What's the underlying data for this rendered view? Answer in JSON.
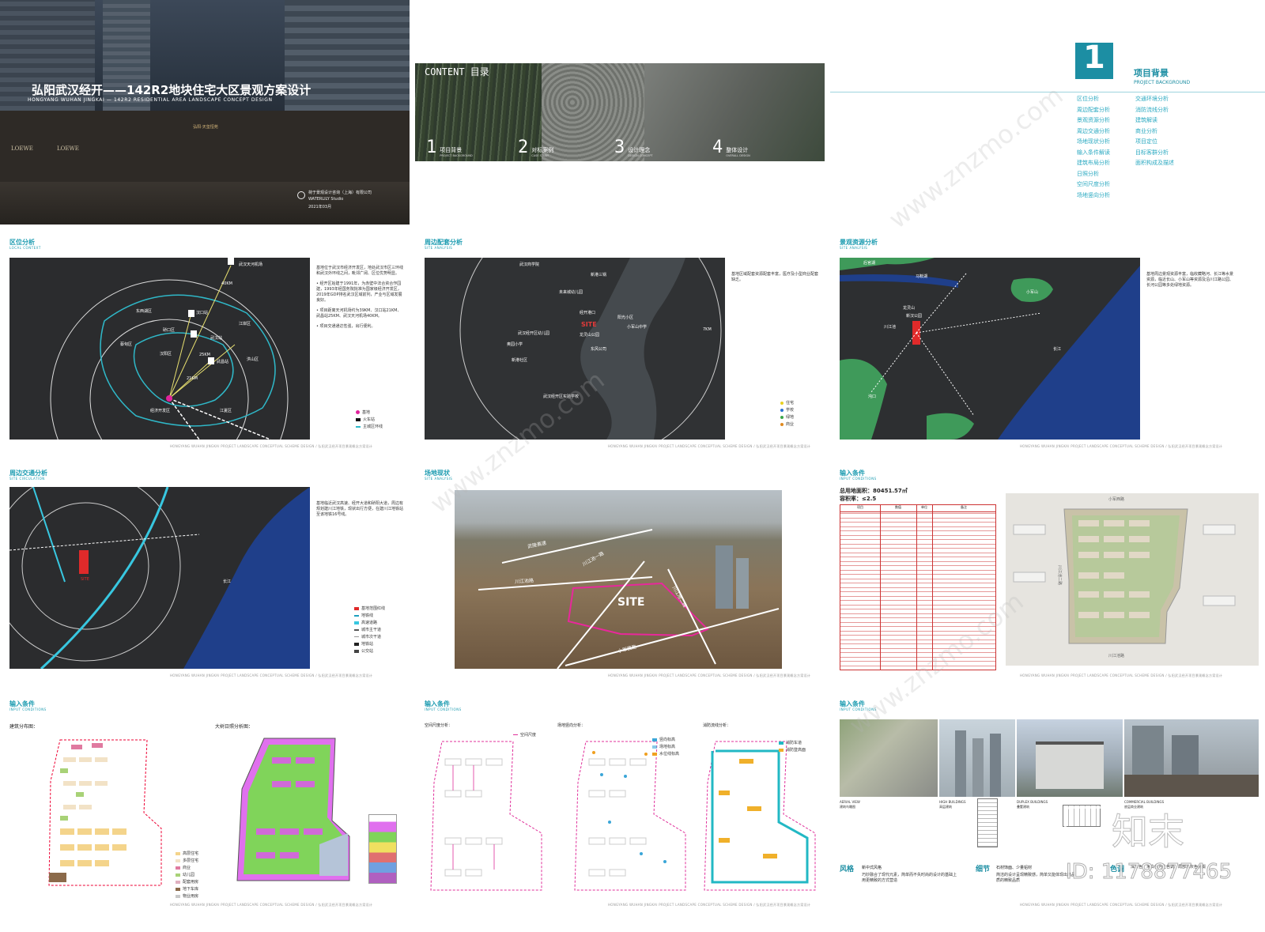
{
  "cover": {
    "title": "弘阳武汉经开——142R2地块住宅大区景观方案设计",
    "subtitle": "HONGYANG WUHAN JINGKAI — 142R2 RESIDENTIAL AREA LANDSCAPE CONCEPT DESIGN",
    "company": "荷于景观设计咨询（上海）有限公司",
    "studio": "WATERLILY Studio",
    "date": "2021年03月",
    "sign": "弘阳·天玺恒苑",
    "shops": [
      "LOEWE",
      "LOEWE"
    ]
  },
  "contents": {
    "heading": "CONTENT 目录",
    "items": [
      {
        "num": "1",
        "cn": "项目背景",
        "en": "PROJECT BACKGROUND"
      },
      {
        "num": "2",
        "cn": "对标案例",
        "en": "CASE STUDY"
      },
      {
        "num": "3",
        "cn": "设计理念",
        "en": "DESIGN CONCEPT"
      },
      {
        "num": "4",
        "cn": "整体设计",
        "en": "OVERALL DESIGN"
      }
    ]
  },
  "background": {
    "num": "1",
    "title": "项目背景",
    "title_en": "PROJECT BACKGROUND",
    "col1": [
      "区位分析",
      "周边配套分析",
      "景观资源分析",
      "周边交通分析",
      "场地现状分析",
      "输入条件解读",
      "建筑布局分析",
      "日照分析",
      "空间尺度分析",
      "场地竖向分析"
    ],
    "col2": [
      "交通环境分析",
      "消防流线分析",
      "建筑解读",
      "商业分析",
      "项目定位",
      "目标客群分析",
      "面积构成及描述"
    ]
  },
  "location": {
    "cap": "区位分析",
    "cap_en": "LOCAL CONTEXT",
    "labels": [
      "武汉天河机场",
      "东西湖区",
      "硚口区",
      "江岸区",
      "汉阳区",
      "蔡甸区",
      "洪山区",
      "江夏区",
      "武昌站",
      "汉口站",
      "武汉站",
      "经济开发区",
      "21KM",
      "25KM",
      "40KM"
    ],
    "text": [
      "基地位于武汉市经济开发区，地处武汉市区三环线和武汉外环线之间，毗邻广阔、区位优势明显。",
      "• 经开区始建于1991年，为赤壁中法合资合作园建，1993年经国务院批准为国家级经济开发区，2019年GDP排名武汉区域前列，产业与区域发展良好。",
      "• 项目距离天河机场约为39KM、汉口站21KM、武昌站25KM、武汉天河机场40KM。",
      "• 项目交通通达性强，出行便利。"
    ],
    "legend": [
      "基地",
      "火车站",
      "主城区环线"
    ]
  },
  "amenities": {
    "cap": "周边配套分析",
    "cap_en": "SITE ANALYSIS",
    "text": "基地区域配套资源配套丰富，医疗及小型商业配套缺乏。",
    "ring": "7KM",
    "site": "SITE",
    "labels": [
      "武汉商学院",
      "新港三锅",
      "经开港口",
      "未来城幼儿园",
      "武汉经开区幼儿园",
      "阳光小区",
      "小军山中学",
      "龙灵山公园",
      "东风公司",
      "奥园小学",
      "新港社区",
      "武汉经开区实验学校"
    ],
    "legend": [
      "住宅",
      "学校",
      "绿地",
      "商业"
    ]
  },
  "landscape": {
    "cap": "景观资源分析",
    "cap_en": "SITE ANALYSIS",
    "text": "基地周边景观资源丰富，临收藏略河、长江等水景资源，临近长山、小军山等资源及沿川江路公园、长河公园等多处绿地资源。",
    "labels": [
      "后官湖",
      "马鞍湖",
      "长江",
      "川江池",
      "新汉公园",
      "小军山",
      "龙灵山",
      "沌口"
    ]
  },
  "traffic": {
    "cap": "周边交通分析",
    "cap_en": "SITE CIRCULATION",
    "text": "基地临近武汉高速、经开大道和硚阳大道，周边有规划建川江地铁，现状出行方便，在建川江地铁站至该地铁16号线。",
    "labels": [
      "长江",
      "SITE"
    ],
    "legend": [
      "基地范围红线",
      "地铁线",
      "高速道路",
      "城市主干道",
      "城市次干道",
      "地铁站",
      "公交站"
    ]
  },
  "site_status": {
    "cap": "场地现状",
    "cap_en": "SITE ANALYSIS",
    "roads": [
      "武陵高速",
      "川江池一路",
      "川江池路",
      "川江池二路",
      "小军西路"
    ],
    "site": "SITE"
  },
  "input1": {
    "cap": "输入条件",
    "cap_en": "INPUT CONDITIONS",
    "area": "总用地面积：80451.57㎡",
    "far": "容积率：≤2.5",
    "table_head": [
      "项目",
      "数值",
      "单位",
      "备注"
    ],
    "roads": [
      "小军西路",
      "川江池路",
      "川江池二路"
    ]
  },
  "input2": {
    "cap": "输入条件",
    "cap_en": "INPUT CONDITIONS",
    "plan1": "建筑分布图：",
    "plan2": "大树日照分析图：",
    "legend1": [
      "高层住宅",
      "多层住宅",
      "商业",
      "幼儿园",
      "配套用房",
      "地下车库",
      "物业用房"
    ]
  },
  "input3": {
    "cap": "输入条件",
    "cap_en": "INPUT CONDITIONS",
    "plans": [
      "空间尺度分析：",
      "场地竖向分析：",
      "消防流线分析："
    ],
    "legends": [
      [
        "空间尺度"
      ],
      [
        "竖向标高",
        "场地标高",
        "水位线标高"
      ],
      [
        "消防车道",
        "消防登高面"
      ]
    ]
  },
  "input4": {
    "cap": "输入条件",
    "cap_en": "INPUT CONDITIONS",
    "photos": [
      {
        "en": "AERIAL VIEW",
        "cn": "建筑鸟瞰图"
      },
      {
        "en": "HIGH BUILDINGS",
        "cn": "高层建筑"
      },
      {
        "en": "DUPLEX BUILDINGS",
        "cn": "叠墅建筑"
      },
      {
        "en": "COMMERCIAL BUILDINGS",
        "cn": "底层商业建筑"
      }
    ],
    "style_t": "风格",
    "style_s": "新中式风格",
    "style_d": "巧妙融合了现代元素，简单而不失时尚的设计的基础上用更精致的方式营造",
    "detail_t": "细节",
    "detail_s": "石材饰面、少量铝材",
    "detail_d": "简洁的设计呈现精致感，简单又能体现出高品质的精致品质",
    "color_t": "色调",
    "color_s": "深灰色、米白色为主色调、局部浅灰色点缀"
  },
  "footer": "HONGYANG WUHAN JINGKAI PROJECT LANDSCAPE CONCEPTUAL SCHEME DESIGN / 弘阳武汉经开项目景观概念方案设计",
  "watermark": {
    "brand": "知末",
    "id": "ID: 1178877465",
    "url": "www.znzmo.com"
  }
}
